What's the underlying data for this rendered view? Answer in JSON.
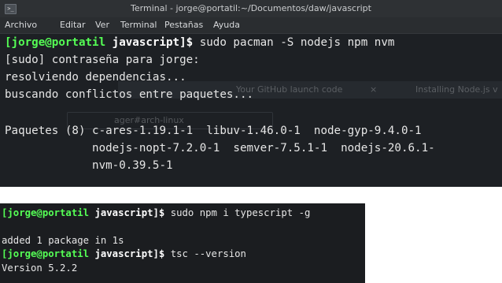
{
  "window1": {
    "title": "Terminal - jorge@portatil:~/Documentos/daw/javascript",
    "terminal_icon_glyph": ">_",
    "menu": [
      "Archivo",
      "Editar",
      "Ver",
      "Terminal",
      "Pestañas",
      "Ayuda"
    ],
    "prompt_user": "[jorge@portatil",
    "prompt_dir": " javascript]$",
    "command": " sudo pacman -S nodejs npm nvm",
    "lines": [
      "[sudo] contraseña para jorge:",
      "resolviendo dependencias...",
      "buscando conflictos entre paquetes..."
    ],
    "packages_lines": [
      "Paquetes (8) c-ares-1.19.1-1  libuv-1.46.0-1  node-gyp-9.4.0-1",
      "             nodejs-nopt-7.2.0-1  semver-7.5.1-1  nodejs-20.6.1-",
      "             nvm-0.39.5-1"
    ],
    "background_ghost": {
      "tab1": "Your GitHub launch code",
      "tab1_close": "×",
      "tab2": "Installing Node.js v",
      "url_fragment": "ager#arch-linux"
    }
  },
  "window2": {
    "line1_user": "[jorge@portatil",
    "line1_dir": " javascript]$",
    "line1_cmd": " sudo npm i typescript -g",
    "line2": "",
    "line3": "added 1 package in 1s",
    "line4_user": "[jorge@portatil",
    "line4_dir": " javascript]$",
    "line4_cmd": " tsc --version",
    "line5": "Version 5.2.2"
  },
  "colors": {
    "prompt_user": "#55ff55",
    "terminal_bg": "#1d2024",
    "titlebar_bg": "#2e3134"
  }
}
